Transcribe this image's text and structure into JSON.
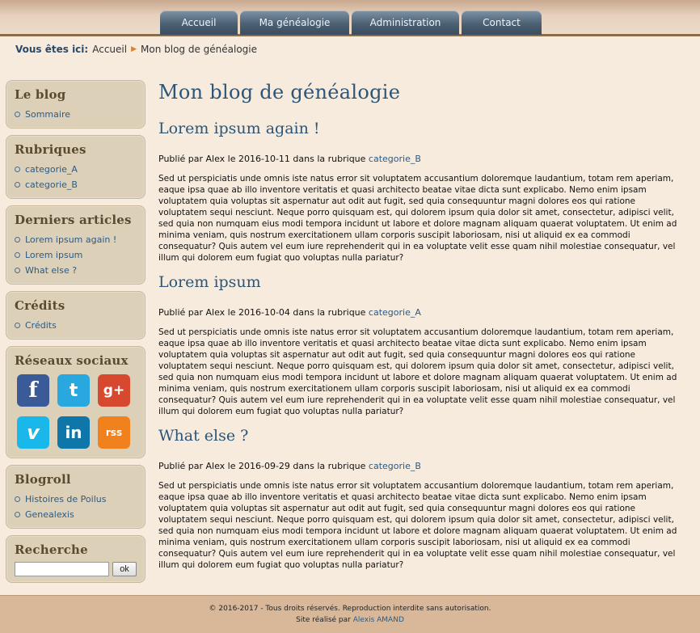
{
  "nav": {
    "items": [
      {
        "label": "Accueil"
      },
      {
        "label": "Ma généalogie"
      },
      {
        "label": "Administration"
      },
      {
        "label": "Contact"
      }
    ]
  },
  "breadcrumb": {
    "prefix": "Vous êtes ici:",
    "home": "Accueil",
    "current": "Mon blog de généalogie"
  },
  "sidebar": {
    "blog": {
      "title": "Le blog",
      "items": [
        "Sommaire"
      ]
    },
    "rubriques": {
      "title": "Rubriques",
      "items": [
        "categorie_A",
        "categorie_B"
      ]
    },
    "derniers": {
      "title": "Derniers articles",
      "items": [
        "Lorem ipsum again !",
        "Lorem ipsum",
        "What else ?"
      ]
    },
    "credits": {
      "title": "Crédits",
      "items": [
        "Crédits"
      ]
    },
    "social": {
      "title": "Réseaux sociaux",
      "icons": [
        "facebook-icon",
        "twitter-icon",
        "google-plus-icon",
        "vimeo-icon",
        "linkedin-icon",
        "rss-icon"
      ],
      "glyphs": [
        "f",
        "t",
        "g+",
        "v",
        "in",
        "rss"
      ]
    },
    "blogroll": {
      "title": "Blogroll",
      "items": [
        "Histoires de Poilus",
        "Genealexis"
      ]
    },
    "search": {
      "title": "Recherche",
      "value": "",
      "button": "ok"
    }
  },
  "main": {
    "title": "Mon blog de généalogie",
    "posts": [
      {
        "title": "Lorem ipsum again !",
        "meta_prefix": "Publié par Alex le 2016-10-11 dans la rubrique",
        "category": "categorie_B",
        "body": "Sed ut perspiciatis unde omnis iste natus error sit voluptatem accusantium doloremque laudantium, totam rem aperiam, eaque ipsa quae ab illo inventore veritatis et quasi architecto beatae vitae dicta sunt explicabo. Nemo enim ipsam voluptatem quia voluptas sit aspernatur aut odit aut fugit, sed quia consequuntur magni dolores eos qui ratione voluptatem sequi nesciunt. Neque porro quisquam est, qui dolorem ipsum quia dolor sit amet, consectetur, adipisci velit, sed quia non numquam eius modi tempora incidunt ut labore et dolore magnam aliquam quaerat voluptatem. Ut enim ad minima veniam, quis nostrum exercitationem ullam corporis suscipit laboriosam, nisi ut aliquid ex ea commodi consequatur? Quis autem vel eum iure reprehenderit qui in ea voluptate velit esse quam nihil molestiae consequatur, vel illum qui dolorem eum fugiat quo voluptas nulla pariatur?"
      },
      {
        "title": "Lorem ipsum",
        "meta_prefix": "Publié par Alex le 2016-10-04 dans la rubrique",
        "category": "categorie_A",
        "body": "Sed ut perspiciatis unde omnis iste natus error sit voluptatem accusantium doloremque laudantium, totam rem aperiam, eaque ipsa quae ab illo inventore veritatis et quasi architecto beatae vitae dicta sunt explicabo. Nemo enim ipsam voluptatem quia voluptas sit aspernatur aut odit aut fugit, sed quia consequuntur magni dolores eos qui ratione voluptatem sequi nesciunt. Neque porro quisquam est, qui dolorem ipsum quia dolor sit amet, consectetur, adipisci velit, sed quia non numquam eius modi tempora incidunt ut labore et dolore magnam aliquam quaerat voluptatem. Ut enim ad minima veniam, quis nostrum exercitationem ullam corporis suscipit laboriosam, nisi ut aliquid ex ea commodi consequatur? Quis autem vel eum iure reprehenderit qui in ea voluptate velit esse quam nihil molestiae consequatur, vel illum qui dolorem eum fugiat quo voluptas nulla pariatur?"
      },
      {
        "title": "What else ?",
        "meta_prefix": "Publié par Alex le 2016-09-29 dans la rubrique",
        "category": "categorie_B",
        "body": "Sed ut perspiciatis unde omnis iste natus error sit voluptatem accusantium doloremque laudantium, totam rem aperiam, eaque ipsa quae ab illo inventore veritatis et quasi architecto beatae vitae dicta sunt explicabo. Nemo enim ipsam voluptatem quia voluptas sit aspernatur aut odit aut fugit, sed quia consequuntur magni dolores eos qui ratione voluptatem sequi nesciunt. Neque porro quisquam est, qui dolorem ipsum quia dolor sit amet, consectetur, adipisci velit, sed quia non numquam eius modi tempora incidunt ut labore et dolore magnam aliquam quaerat voluptatem. Ut enim ad minima veniam, quis nostrum exercitationem ullam corporis suscipit laboriosam, nisi ut aliquid ex ea commodi consequatur? Quis autem vel eum iure reprehenderit qui in ea voluptate velit esse quam nihil molestiae consequatur, vel illum qui dolorem eum fugiat quo voluptas nulla pariatur?"
      }
    ]
  },
  "footer": {
    "copyright": "© 2016-2017 - Tous droits réservés. Reproduction interdite sans autorisation.",
    "credit_prefix": "Site réalisé par",
    "author": "Alexis AMAND"
  },
  "colors": {
    "nav_tab": "#4d6174",
    "heading": "#2c5578",
    "link": "#2c5a82",
    "sidebar_box": "#ddd0b9",
    "background": "#f7ebdd",
    "footer": "#d9b89a",
    "facebook": "#3b5a98",
    "twitter": "#29a8e0",
    "google_plus": "#d6492f",
    "vimeo": "#1ab7ea",
    "linkedin": "#0e76a8",
    "rss": "#f0811d"
  }
}
